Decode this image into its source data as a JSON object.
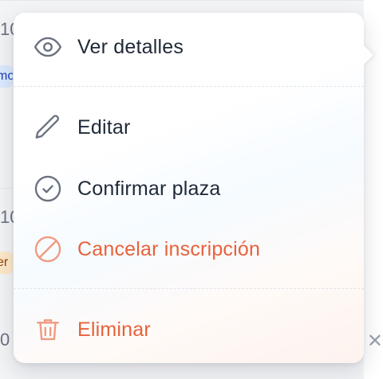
{
  "background": {
    "row_texts": [
      "10",
      "10",
      "0"
    ],
    "badges": [
      {
        "text": "mo",
        "color": "#dbeafe"
      },
      {
        "text": "er",
        "color": "#fde9c8"
      }
    ],
    "close_glyph": "✕"
  },
  "menu": {
    "items": [
      {
        "label": "Ver detalles",
        "icon": "eye-icon",
        "variant": "neutral"
      },
      {
        "label": "Editar",
        "icon": "pencil-icon",
        "variant": "neutral"
      },
      {
        "label": "Confirmar plaza",
        "icon": "check-circle-icon",
        "variant": "neutral"
      },
      {
        "label": "Cancelar inscripción",
        "icon": "ban-icon",
        "variant": "danger"
      },
      {
        "label": "Eliminar",
        "icon": "trash-icon",
        "variant": "danger"
      }
    ]
  },
  "colors": {
    "text": "#1f2937",
    "icon": "#6b7280",
    "danger": "#e8613a"
  }
}
